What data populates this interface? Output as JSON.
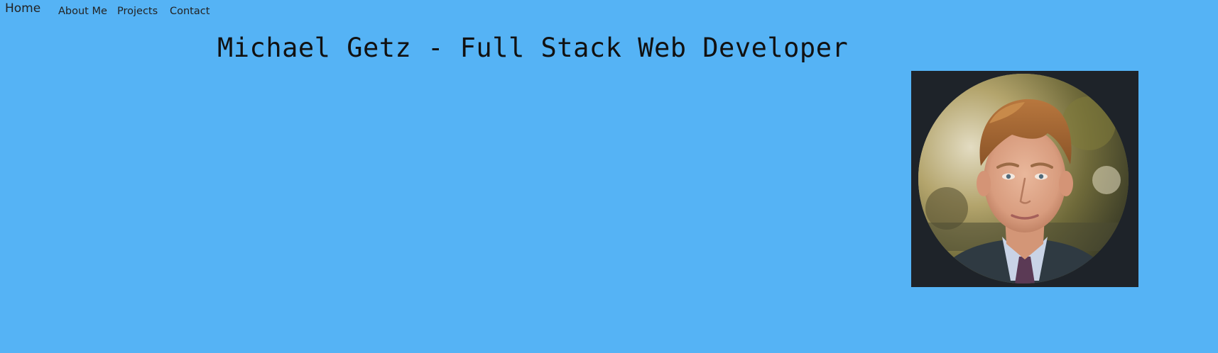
{
  "nav": {
    "brand": "Home",
    "links": [
      {
        "label": "About Me"
      },
      {
        "label": "Projects"
      },
      {
        "label": "Contact"
      }
    ]
  },
  "header": {
    "title": "Michael Getz - Full Stack Web Developer"
  },
  "profile": {
    "photo_icon": "profile-photo",
    "card_color": "#1e2329",
    "background_color": "#55b3f5"
  }
}
